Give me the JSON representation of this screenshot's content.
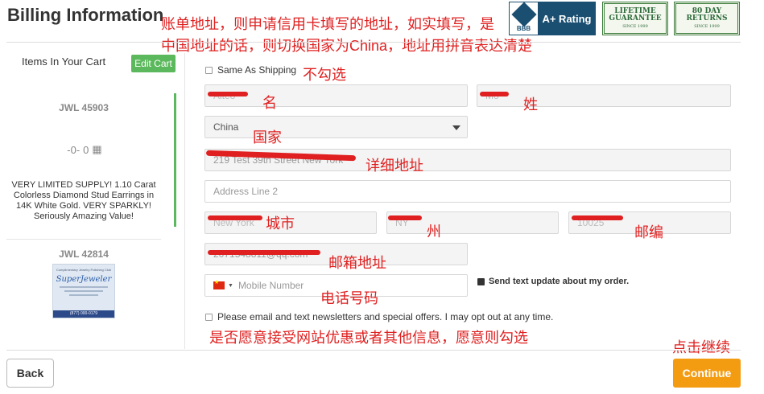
{
  "header": {
    "title": "Billing Information",
    "bbb_label": "BBB",
    "rating": "A+ Rating",
    "badge_lifetime": "LIFETIME GUARANTEE",
    "badge_lifetime_sub": "SINCE 1999",
    "badge_returns": "80 DAY RETURNS",
    "badge_returns_sub": "SINCE 1999"
  },
  "sidebar": {
    "title": "Items In Your Cart",
    "edit_cart": "Edit Cart",
    "items": [
      {
        "sku": "JWL 45903",
        "description": "VERY LIMITED SUPPLY! 1.10 Carat Colorless Diamond Stud Earrings in 14K White Gold. VERY SPARKLY! Seriously Amazing Value!"
      },
      {
        "sku": "JWL 42814",
        "image_brand": "SuperJeweler",
        "image_top_text": "Complimentary Jewelry Polishing Club",
        "image_footer": "(877) 000-0179"
      }
    ]
  },
  "form": {
    "same_as_shipping": {
      "label": "Same As Shipping",
      "checked": false
    },
    "first_name": "Aiteo",
    "last_name": "Mo",
    "country": "China",
    "address_line1": "219 Test 39th Street New York",
    "address_line2_placeholder": "Address Line 2",
    "city": "New York",
    "state": "NY",
    "zip": "10025",
    "email": "2071548811@qq.com",
    "phone_placeholder": "Mobile Number",
    "send_text": {
      "label": "Send text update about my order.",
      "checked": true
    },
    "newsletter": {
      "label": "Please email and text newsletters and special offers. I may opt out at any time.",
      "checked": false
    }
  },
  "annotations": {
    "billing_note_line1": "账单地址，则申请信用卡填写的地址，如实填写，是",
    "billing_note_line2": "中国地址的话，则切换国家为China，地址用拼音表达清楚",
    "not_checked": "不勾选",
    "first_name": "名",
    "last_name": "姓",
    "country": "国家",
    "address": "详细地址",
    "city": "城市",
    "state": "州",
    "zip": "邮编",
    "email": "邮箱地址",
    "phone": "电话号码",
    "newsletter": "是否愿意接受网站优惠或者其他信息，愿意则勾选",
    "continue": "点击继续"
  },
  "footer": {
    "back": "Back",
    "continue": "Continue"
  },
  "colors": {
    "accent_green": "#5cb85c",
    "continue_orange": "#f39c12",
    "annotation_red": "#e02020",
    "bbb_navy": "#1b4f72"
  },
  "icons": {
    "flag": "china-flag-icon",
    "dropdown": "caret-down-icon"
  }
}
